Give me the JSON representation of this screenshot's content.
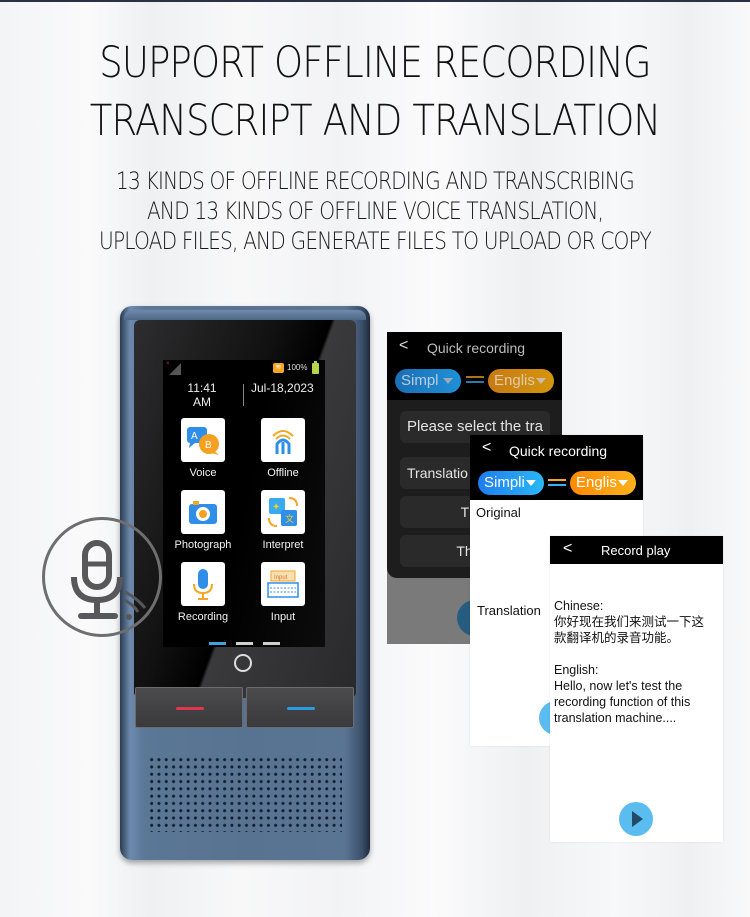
{
  "headline": {
    "line1": "SUPPORT OFFLINE RECORDING",
    "line2": "TRANSCRIPT AND TRANSLATION"
  },
  "subheadline": {
    "line1": "13 KINDS OF OFFLINE RECORDING AND TRANSCRIBING",
    "line2": "AND 13 KINDS OF OFFLINE VOICE TRANSLATION,",
    "line3": "UPLOAD FILES, AND GENERATE FILES TO UPLOAD OR COPY"
  },
  "device": {
    "status": {
      "signal_icon": "signal-icon",
      "wifi_icon": "wifi-icon",
      "battery_percent": "100%",
      "battery_icon": "battery-icon"
    },
    "time_line1": "11:41",
    "time_line2": "AM",
    "date": "Jul-18,2023",
    "apps": [
      {
        "label": "Voice",
        "icon": "voice-translate-icon"
      },
      {
        "label": "Offline",
        "icon": "offline-icon"
      },
      {
        "label": "Photograph",
        "icon": "camera-icon"
      },
      {
        "label": "Interpret",
        "icon": "interpret-icon"
      },
      {
        "label": "Recording",
        "icon": "microphone-icon"
      },
      {
        "label": "Input",
        "icon": "keyboard-icon"
      }
    ],
    "pager": {
      "pages": 3,
      "active_page": 1
    },
    "buttons": {
      "left_color": "#e0384a",
      "right_color": "#2a9be3"
    }
  },
  "screens": {
    "quick_recording_dark": {
      "title": "Quick recording",
      "source_lang": "Simpl",
      "target_lang": "Englis",
      "rows": [
        "Please select the tra",
        "Translatio",
        "The o",
        "The tra"
      ]
    },
    "quick_recording_light": {
      "title": "Quick recording",
      "source_lang": "Simpli",
      "target_lang": "Englis",
      "original_label": "Original",
      "translation_label": "Translation"
    },
    "record_play": {
      "title": "Record play",
      "chinese_label": "Chinese:",
      "chinese_text": "你好现在我们来测试一下这\n款翻译机的录音功能。",
      "english_label": "English:",
      "english_text": "Hello, now let's test the\nrecording function of this\ntranslation machine...."
    }
  },
  "colors": {
    "source_pill": "#1e90ff",
    "target_pill": "#ff9f1a",
    "accent_blue": "#5bbcf0"
  }
}
